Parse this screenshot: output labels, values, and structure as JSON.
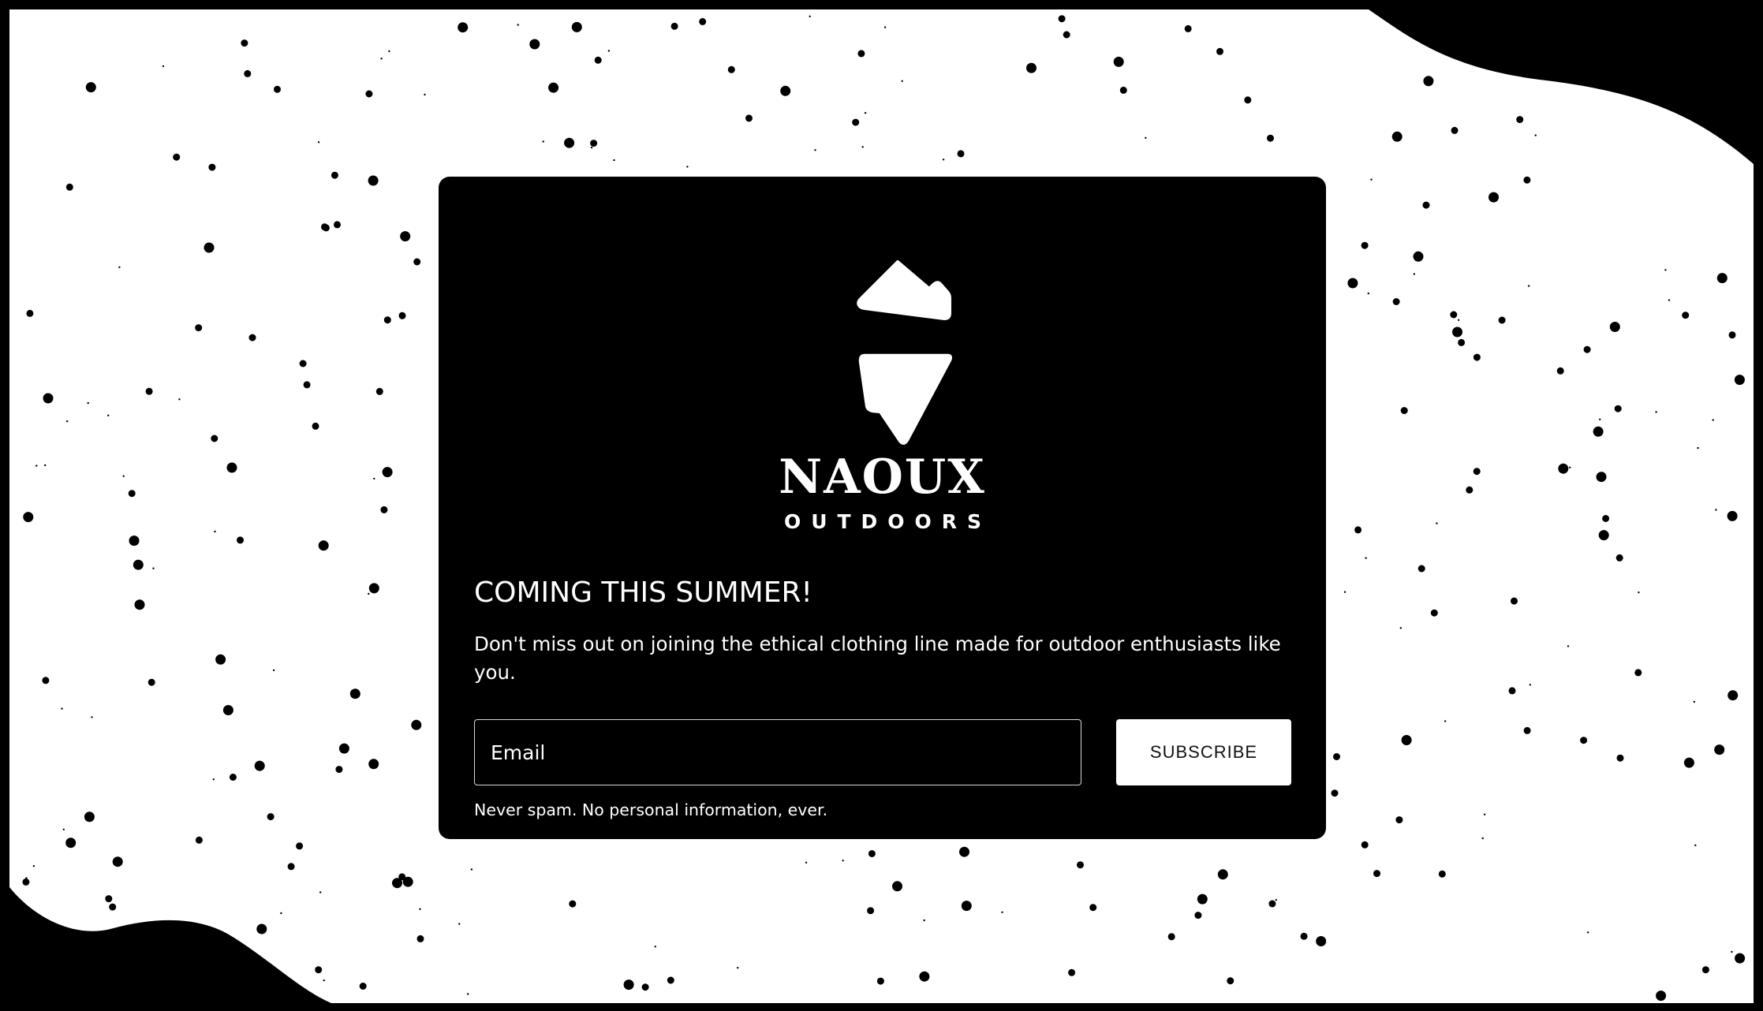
{
  "brand": {
    "name": "NAOUX",
    "tagline": "OUTDOORS",
    "logo_icon": "split-diamond-mountain-icon"
  },
  "signup": {
    "headline": "COMING THIS SUMMER!",
    "description": "Don't miss out on joining the ethical clothing line made for outdoor enthusiasts like you.",
    "email_placeholder": "Email",
    "email_value": "",
    "subscribe_label": "SUBSCRIBE",
    "disclaimer": "Never spam. No personal information, ever."
  },
  "colors": {
    "frame": "#000000",
    "background": "#ffffff",
    "speckles": "#000000",
    "modal": "#000000",
    "text": "#ffffff",
    "button_bg": "#ffffff",
    "button_text": "#111111"
  }
}
